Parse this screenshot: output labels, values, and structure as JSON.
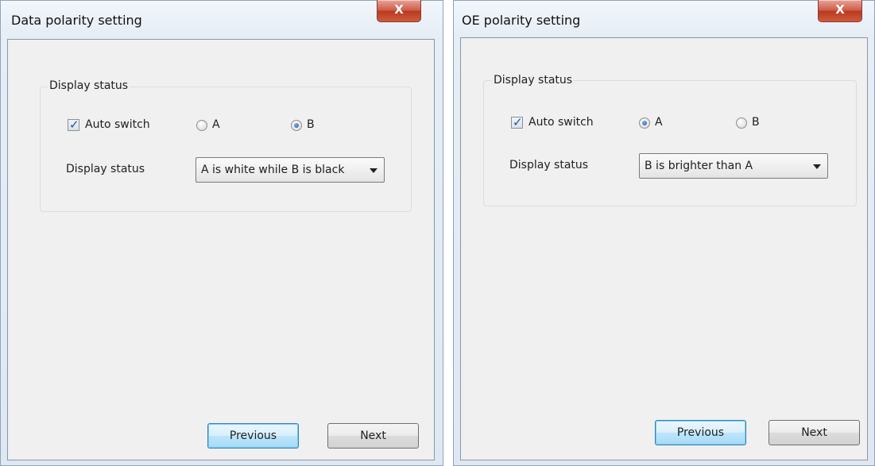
{
  "dialogs": [
    {
      "title": "Data polarity setting",
      "close_label": "X",
      "group_label": "Display status",
      "auto_switch_label": "Auto switch",
      "auto_switch_checked": true,
      "radio_a_label": "A",
      "radio_b_label": "B",
      "selected_radio": "B",
      "display_status_label": "Display status",
      "display_status_value": "A is white while B is black",
      "previous_label": "Previous",
      "next_label": "Next"
    },
    {
      "title": "OE polarity setting",
      "close_label": "X",
      "group_label": "Display status",
      "auto_switch_label": "Auto switch",
      "auto_switch_checked": true,
      "radio_a_label": "A",
      "radio_b_label": "B",
      "selected_radio": "A",
      "display_status_label": "Display status",
      "display_status_value": "B is brighter than A",
      "previous_label": "Previous",
      "next_label": "Next"
    }
  ],
  "colors": {
    "close_button": "#c9472f",
    "default_button_border": "#3c7fb1",
    "checkmark": "#2b4f9c"
  },
  "icons": {
    "check": "checkmark-icon",
    "dropdown": "chevron-down-icon"
  }
}
